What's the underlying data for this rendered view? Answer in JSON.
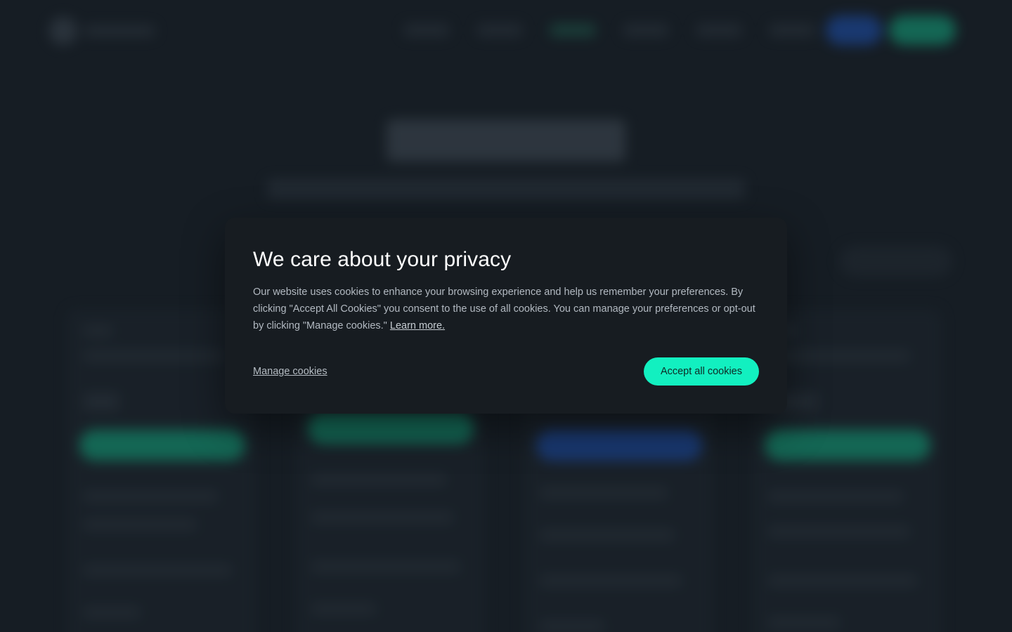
{
  "cookie_modal": {
    "title": "We care about your privacy",
    "body": "Our website uses cookies to enhance your browsing experience and help us remember your preferences. By clicking \"Accept All Cookies\" you consent to the use of all cookies. You can manage your preferences or opt-out by clicking \"Manage cookies.\"",
    "learn_more_label": "Learn more.",
    "manage_label": "Manage cookies",
    "accept_label": "Accept all cookies"
  },
  "colors": {
    "page_background": "#161d24",
    "modal_background": "#171c21",
    "accent": "#12f0c0",
    "secondary_accent": "#1c4fae"
  }
}
